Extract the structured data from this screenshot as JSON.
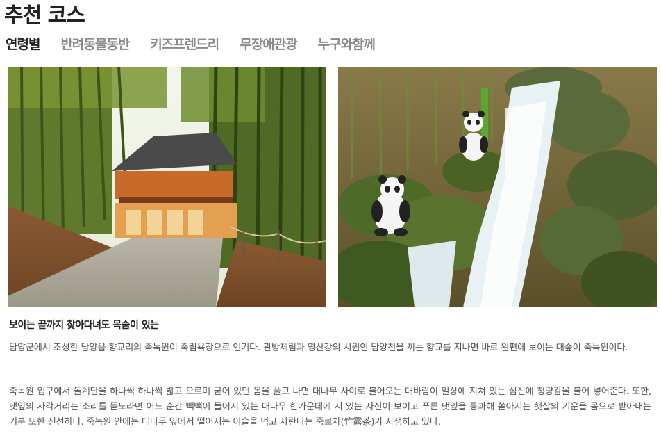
{
  "page": {
    "title": "추천 코스"
  },
  "tabs": [
    {
      "label": "연령별",
      "active": true
    },
    {
      "label": "반려동물동반",
      "active": false
    },
    {
      "label": "키즈프렌드리",
      "active": false
    },
    {
      "label": "무장애관광",
      "active": false
    },
    {
      "label": "누구와함께",
      "active": false
    }
  ],
  "photos": {
    "left": {
      "subject": "bamboo-forest-path-with-traditional-pavilion"
    },
    "right": {
      "subject": "waterfall-with-panda-statues"
    }
  },
  "article": {
    "heading": "보이는 끝까지 찾아다녀도 목숨이 있는",
    "paragraph1": "담양군에서 조성한 담양읍 향교리의 죽녹원이 죽림욕장으로 인기다. 관방제림과 영산강의 시원인 담양천을 끼는 향교를 지나면 바로 왼편에 보이는 대숲이 죽녹원이다.",
    "paragraph2": "죽녹원 입구에서 돌계단을 하나씩 하나씩 밟고 오르며 굳어 있던 몸을 풀고 나면 대나무 사이로 불어오는 대바람이 일상에 지쳐 있는 심신에 청량감을 불어 넣어준다. 또한, 댓잎의 사각거리는 소리를 듣노라면 어느 순간 빽빽이 들어서 있는 대나무 한가운데에 서 있는 자신이 보이고 푸른 댓잎을 통과해 쏟아지는 햇살의 기운을 몸으로 받아내는 기분 또한 신선하다. 죽녹원 안에는 대나무 잎에서 떨어지는 이슬을 먹고 자란다는 죽로차(竹露茶)가 자생하고 있다."
  },
  "colors": {
    "active_tab": "#222222",
    "inactive_tab": "#8a8a8a",
    "body_text": "#555555"
  }
}
